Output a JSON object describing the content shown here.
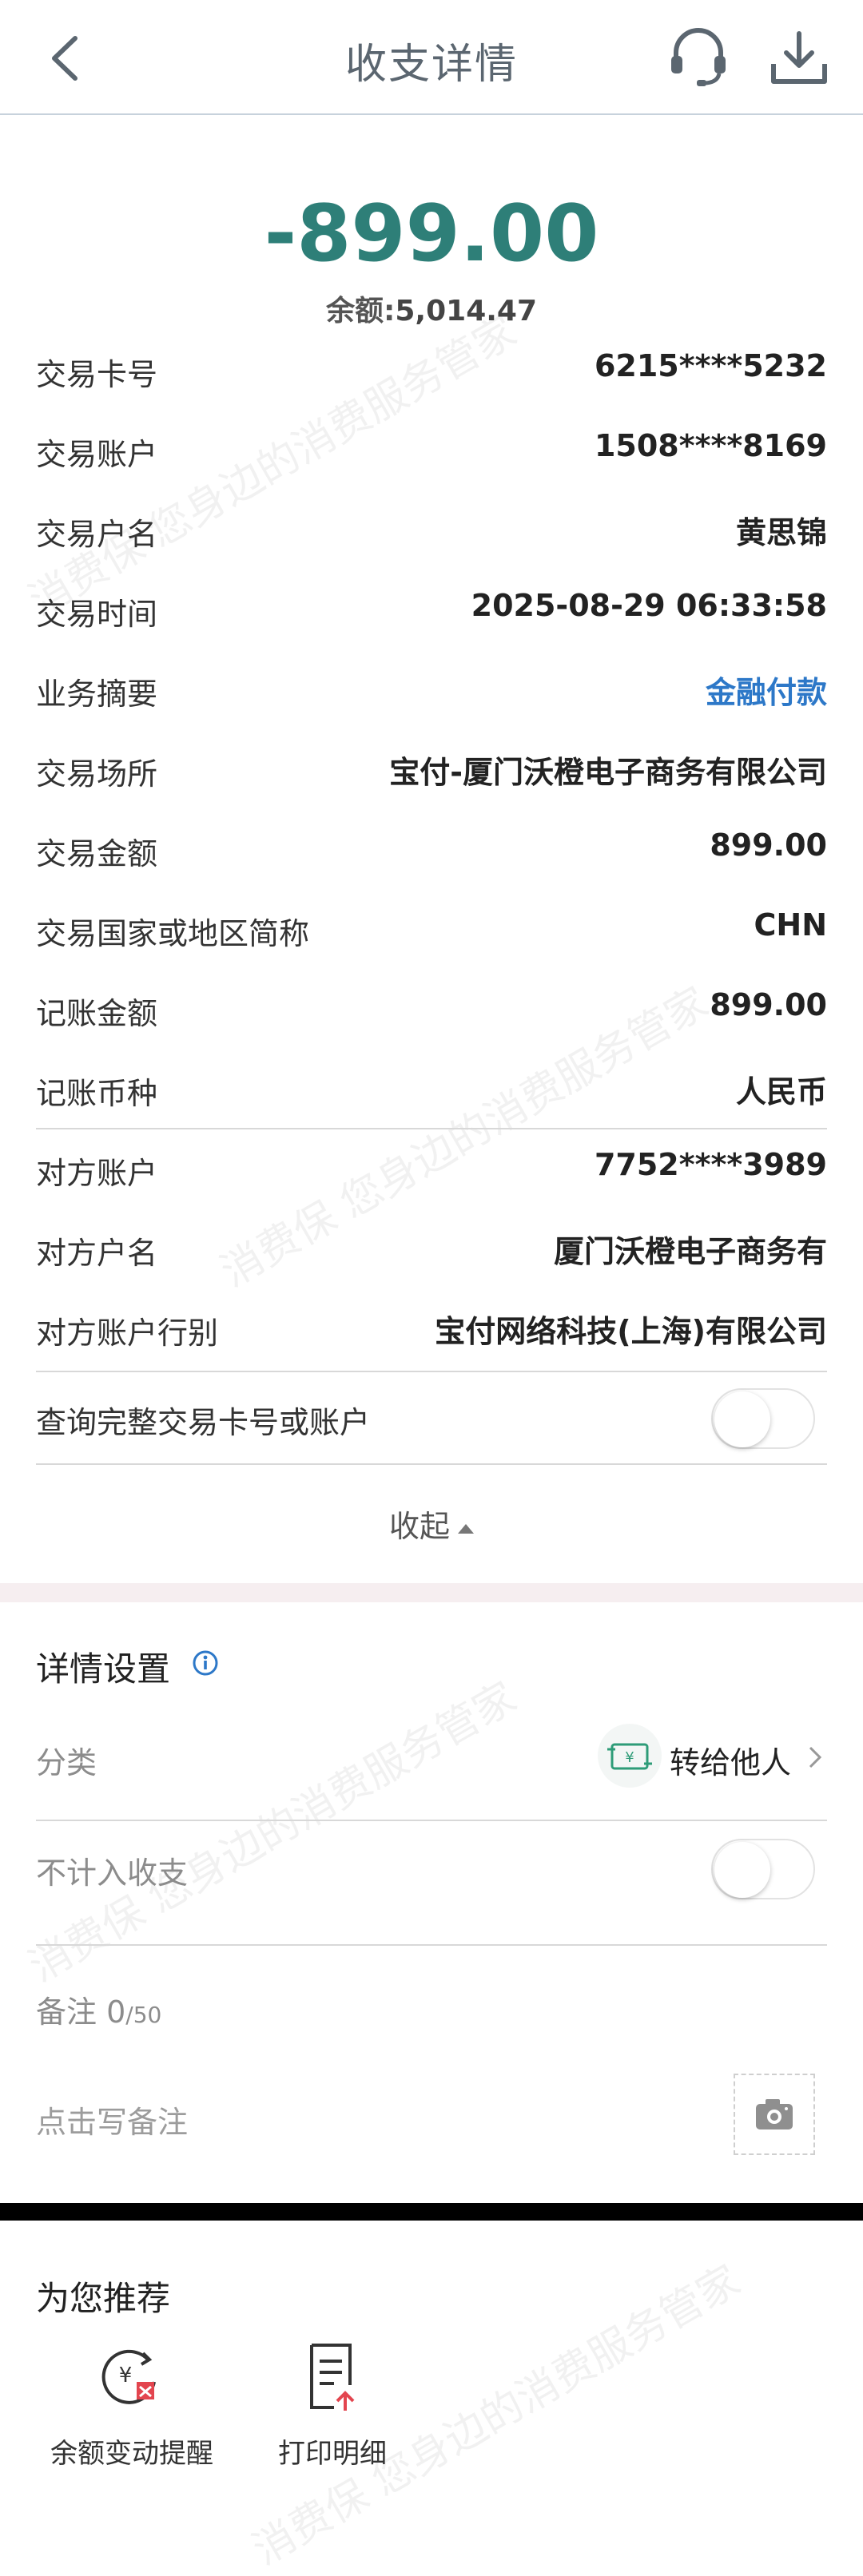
{
  "header": {
    "title": "收支详情",
    "back_icon": "chevron-left-icon",
    "support_icon": "headset-icon",
    "download_icon": "download-icon"
  },
  "summary": {
    "amount": "-899.00",
    "balance_label": "余额:",
    "balance_value": "5,014.47",
    "amount_color": "#2e7f78"
  },
  "details": [
    {
      "label": "交易卡号",
      "value": "6215****5232"
    },
    {
      "label": "交易账户",
      "value": "1508****8169"
    },
    {
      "label": "交易户名",
      "value": "黄思锦"
    },
    {
      "label": "交易时间",
      "value": "2025-08-29 06:33:58"
    },
    {
      "label": "业务摘要",
      "value": "金融付款"
    },
    {
      "label": "交易场所",
      "value": "宝付-厦门沃橙电子商务有限公司"
    },
    {
      "label": "交易金额",
      "value": "899.00"
    },
    {
      "label": "交易国家或地区简称",
      "value": "CHN"
    },
    {
      "label": "记账金额",
      "value": "899.00"
    },
    {
      "label": "记账币种",
      "value": "人民币"
    },
    {
      "label": "对方账户",
      "value": "7752****3989"
    },
    {
      "label": "对方户名",
      "value": "厦门沃橙电子商务有"
    },
    {
      "label": "对方账户行别",
      "value": "宝付网络科技(上海)有限公司"
    }
  ],
  "full_card_toggle": {
    "label": "查询完整交易卡号或账户",
    "on": false
  },
  "collapse_label": "收起",
  "settings": {
    "title": "详情设置",
    "category_label": "分类",
    "category_value": "转给他人",
    "exclude_label": "不计入收支",
    "exclude_on": false,
    "remark_label": "备注",
    "remark_count": "0",
    "remark_max": "/50",
    "remark_placeholder": "点击写备注"
  },
  "recommend": {
    "title": "为您推荐",
    "items": [
      {
        "label": "余额变动提醒",
        "icon": "balance-alert-icon"
      },
      {
        "label": "打印明细",
        "icon": "print-detail-icon"
      }
    ]
  },
  "watermark_text": "消费保 您身边的消费服务管家",
  "colors": {
    "accent": "#2e7f78",
    "link": "#2d78c8",
    "section_gap": "#f6eef0"
  }
}
